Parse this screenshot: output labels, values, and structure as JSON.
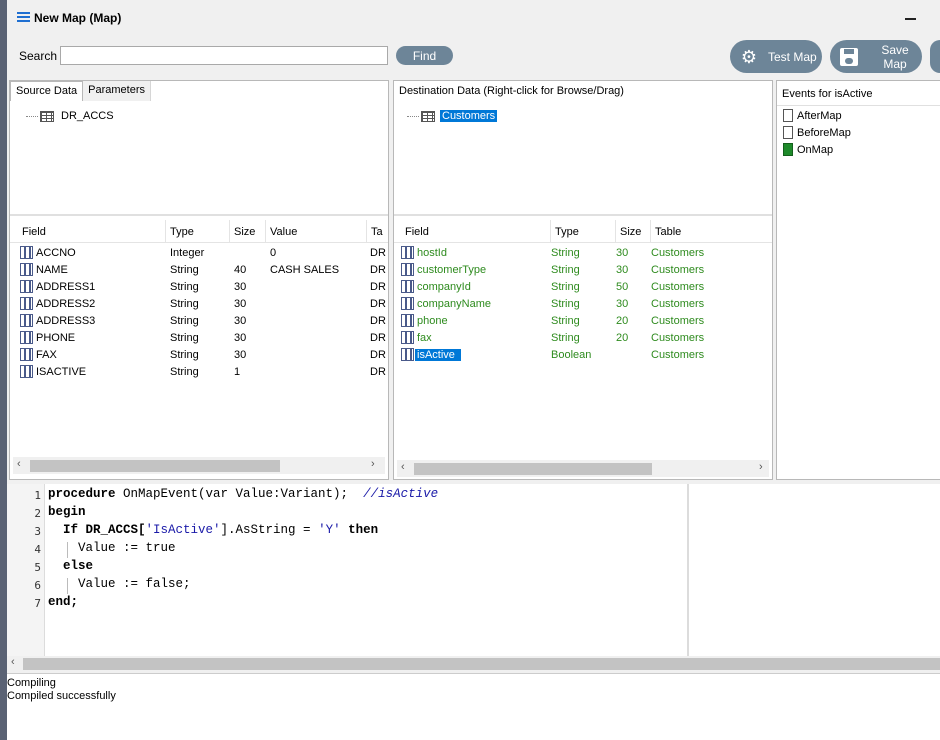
{
  "window": {
    "title": "New Map (Map)"
  },
  "search": {
    "label": "Search",
    "value": "",
    "placeholder": "",
    "find_label": "Find"
  },
  "toolbar": {
    "test_label": "Test Map",
    "save_label": "Save Map"
  },
  "source": {
    "tabs": [
      "Source Data",
      "Parameters"
    ],
    "tree_root": "DR_ACCS",
    "columns": [
      "Field",
      "Type",
      "Size",
      "Value",
      "Ta"
    ],
    "rows": [
      {
        "field": "ACCNO",
        "type": "Integer",
        "size": "",
        "value": "0",
        "table": "DR"
      },
      {
        "field": "NAME",
        "type": "String",
        "size": "40",
        "value": "CASH SALES",
        "table": "DR"
      },
      {
        "field": "ADDRESS1",
        "type": "String",
        "size": "30",
        "value": "",
        "table": "DR"
      },
      {
        "field": "ADDRESS2",
        "type": "String",
        "size": "30",
        "value": "",
        "table": "DR"
      },
      {
        "field": "ADDRESS3",
        "type": "String",
        "size": "30",
        "value": "",
        "table": "DR"
      },
      {
        "field": "PHONE",
        "type": "String",
        "size": "30",
        "value": "",
        "table": "DR"
      },
      {
        "field": "FAX",
        "type": "String",
        "size": "30",
        "value": "",
        "table": "DR"
      },
      {
        "field": "ISACTIVE",
        "type": "String",
        "size": "1",
        "value": "",
        "table": "DR"
      }
    ]
  },
  "destination": {
    "header": "Destination Data   (Right-click for Browse/Drag)",
    "tree_root": "Customers",
    "columns": [
      "Field",
      "Type",
      "Size",
      "Table"
    ],
    "rows": [
      {
        "field": "hostId",
        "type": "String",
        "size": "30",
        "table": "Customers"
      },
      {
        "field": "customerType",
        "type": "String",
        "size": "30",
        "table": "Customers"
      },
      {
        "field": "companyId",
        "type": "String",
        "size": "50",
        "table": "Customers"
      },
      {
        "field": "companyName",
        "type": "String",
        "size": "30",
        "table": "Customers"
      },
      {
        "field": "phone",
        "type": "String",
        "size": "20",
        "table": "Customers"
      },
      {
        "field": "fax",
        "type": "String",
        "size": "20",
        "table": "Customers"
      },
      {
        "field": "isActive",
        "type": "Boolean",
        "size": "",
        "table": "Customers"
      }
    ]
  },
  "events": {
    "header": "Events for isActive",
    "items": [
      "AfterMap",
      "BeforeMap",
      "OnMap"
    ]
  },
  "code": {
    "line_numbers": [
      "1",
      "2",
      "3",
      "4",
      "5",
      "6",
      "7"
    ],
    "l1_kw": "procedure",
    "l1_rest": " OnMapEvent(var Value:Variant);  ",
    "l1_comment": "//isActive",
    "l2": "begin",
    "l3_a": "  If DR_ACCS[",
    "l3_str1": "'IsActive'",
    "l3_b": "].AsString = ",
    "l3_str2": "'Y'",
    "l3_kw": " then",
    "l4": "    Value := true",
    "l5": "  else",
    "l6": "    Value := false;",
    "l7": "end;"
  },
  "output": {
    "lines": [
      "Compiling",
      "Compiled successfully"
    ]
  },
  "colors": {
    "accent": "#0078d7",
    "button": "#6d8598",
    "dest_text": "#2e8b1e"
  }
}
